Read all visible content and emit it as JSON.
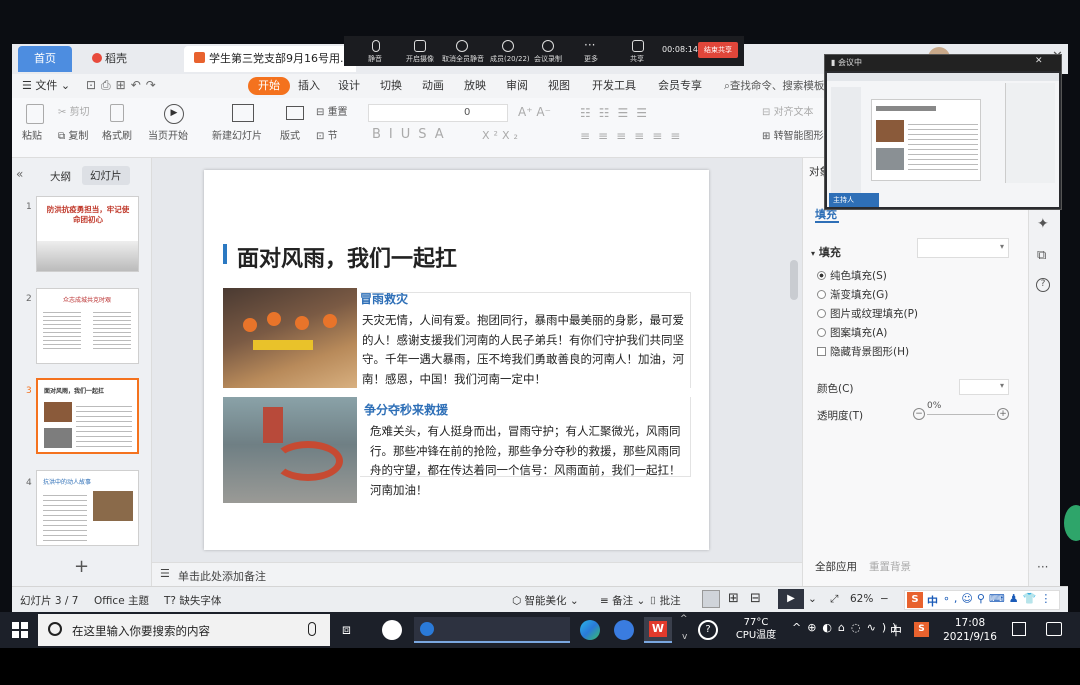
{
  "meeting_bar": {
    "buttons": [
      "静音",
      "开启摄像",
      "取消全员静音",
      "成员(20/22)",
      "会议录制",
      "更多",
      "共享"
    ],
    "timer": "00:08:14",
    "end_label": "结束共享"
  },
  "title_tabs": {
    "home": "首页",
    "docer": "稻壳",
    "document": "学生第三党支部9月16号用.pp"
  },
  "menu": {
    "file": "文件",
    "tabs": [
      "开始",
      "插入",
      "设计",
      "切换",
      "动画",
      "放映",
      "审阅",
      "视图",
      "开发工具",
      "会员专享"
    ],
    "active_tab": "开始",
    "search": "查找命令、搜索模板"
  },
  "ribbon": {
    "paste": "粘贴",
    "cut": "剪切",
    "copy": "复制",
    "format_painter": "格式刷",
    "play_current": "当页开始",
    "new_slide": "新建幻灯片",
    "layout": "版式",
    "reset": "重置",
    "section": "节",
    "font_size": "0",
    "align_text": "对齐文本",
    "convert_smartart": "转智能图形"
  },
  "panel": {
    "outline_tab": "大纲",
    "slides_tab": "幻灯片",
    "add_slide": "+",
    "thumbs": [
      {
        "num": "1",
        "title": "防洪抗疫勇担当，牢记使命团初心"
      },
      {
        "num": "2",
        "title": "众志成城共克时艰"
      },
      {
        "num": "3",
        "title": "面对风雨，我们一起扛"
      },
      {
        "num": "4",
        "title": "抗洪中的动人故事"
      }
    ]
  },
  "slide": {
    "title": "面对风雨，我们一起扛",
    "section1": {
      "heading": "冒雨救灾",
      "text": "天灾无情，人间有爱。抱团同行，暴雨中最美丽的身影，最可爱的人！感谢支援我们河南的人民子弟兵！有你们守护我们共同坚守。千年一遇大暴雨，压不垮我们勇敢善良的河南人！加油，河南！感恩，中国！我们河南一定中！"
    },
    "section2": {
      "heading": "争分夺秒来救援",
      "text": "危难关头，有人挺身而出，冒雨守护；有人汇聚微光，风雨同行。那些冲锋在前的抢险，那些争分夺秒的救援，那些风雨同舟的守望，都在传达着同一个信号：风雨面前，我们一起扛！河南加油！"
    }
  },
  "right_panel": {
    "object_label": "对象",
    "fill_tab": "填充",
    "fill_heading": "填充",
    "options": [
      "纯色填充(S)",
      "渐变填充(G)",
      "图片或纹理填充(P)",
      "图案填充(A)"
    ],
    "hide_bg": "隐藏背景图形(H)",
    "color_label": "颜色(C)",
    "transparency_label": "透明度(T)",
    "transparency_value": "0%",
    "apply_all": "全部应用",
    "reset_bg": "重置背景"
  },
  "notes": {
    "placeholder": "单击此处添加备注"
  },
  "status": {
    "slide_info": "幻灯片 3 / 7",
    "theme": "Office 主题",
    "missing_font": "缺失字体",
    "beautify": "智能美化",
    "notes": "备注",
    "comments": "批注",
    "zoom": "62%",
    "ime": "中"
  },
  "taskbar": {
    "search_placeholder": "在这里输入你要搜索的内容",
    "temp": "77°C",
    "temp_label": "CPU温度",
    "ime": "中",
    "time": "17:08",
    "date": "2021/9/16"
  },
  "preview": {
    "title": "会议中",
    "speaker": "主持人"
  },
  "colors": {
    "accent": "#f4721e",
    "title_bar": "#2b79c2",
    "slide_heading": "#2e6fb7"
  }
}
